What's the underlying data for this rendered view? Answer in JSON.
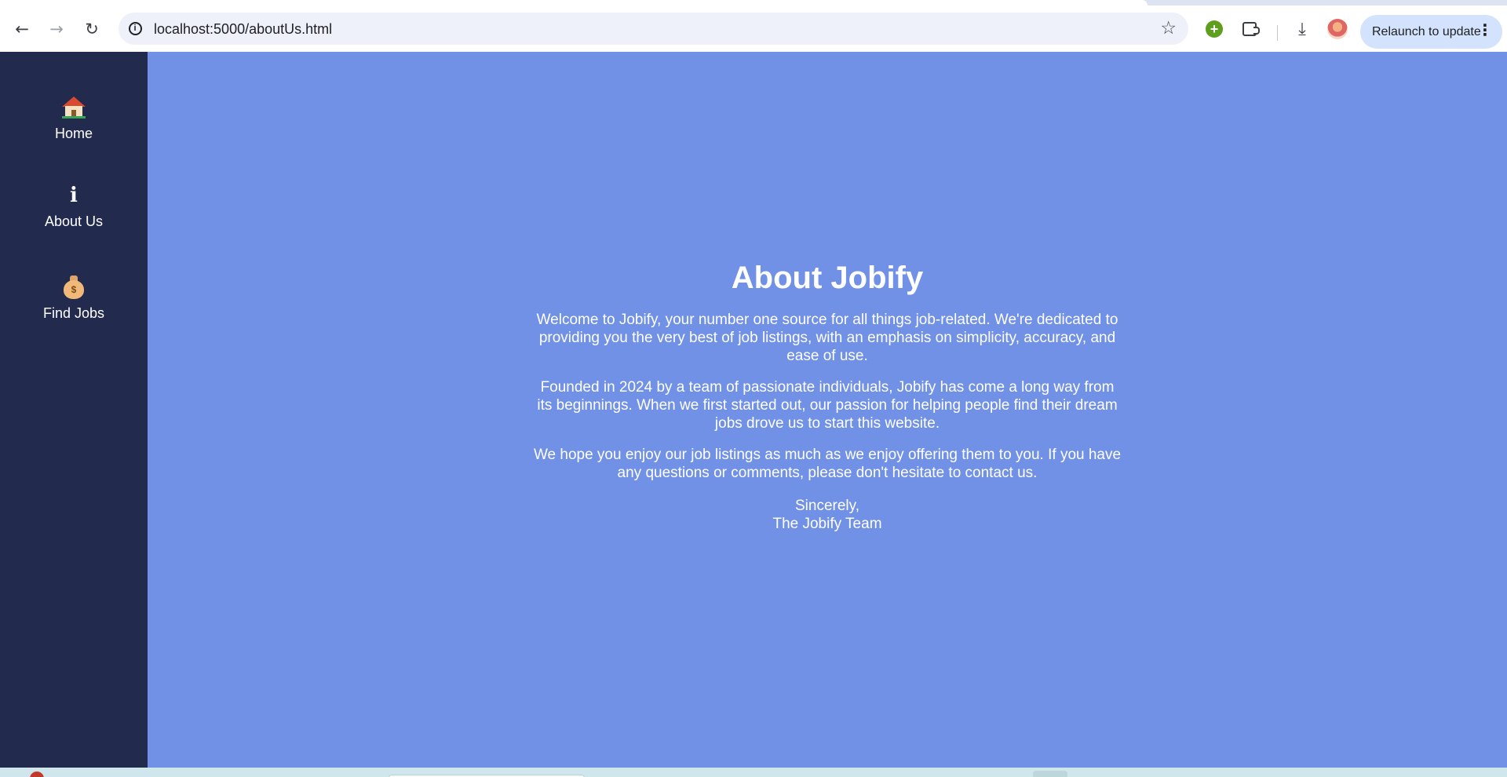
{
  "browser": {
    "back_icon": "arrow-left-icon",
    "forward_icon": "arrow-right-icon",
    "reload_icon": "reload-icon",
    "url": "localhost:5000/aboutUs.html",
    "info_icon": "info-icon",
    "bookmark_icon": "star-icon",
    "relaunch_label": "Relaunch to update"
  },
  "sidebar": {
    "items": [
      {
        "icon": "house-icon",
        "label": "Home"
      },
      {
        "icon": "info-icon",
        "label": "About Us"
      },
      {
        "icon": "money-bag-icon",
        "label": "Find Jobs"
      }
    ]
  },
  "about": {
    "title": "About Jobify",
    "paragraphs": [
      "Welcome to Jobify, your number one source for all things job-related. We're dedicated to providing you the very best of job listings, with an emphasis on simplicity, accuracy, and ease of use.",
      "Founded in 2024 by a team of passionate individuals, Jobify has come a long way from its beginnings. When we first started out, our passion for helping people find their dream jobs drove us to start this website.",
      "We hope you enjoy our job listings as much as we enjoy offering them to you. If you have any questions or comments, please don't hesitate to contact us."
    ],
    "signoff_line1": "Sincerely,",
    "signoff_line2": "The Jobify Team"
  },
  "colors": {
    "sidebar_bg": "#222a4e",
    "page_bg": "#7191e6",
    "text": "#ffffff",
    "relaunch_bg": "#d3e3fd"
  }
}
